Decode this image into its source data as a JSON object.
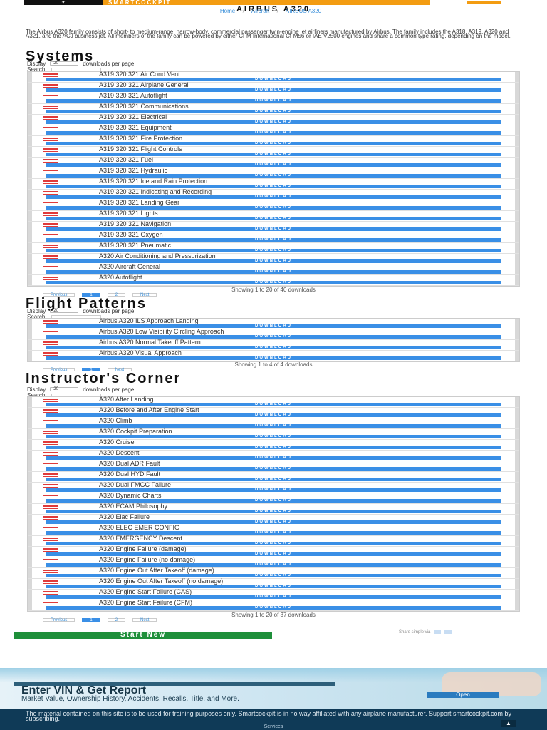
{
  "header": {
    "logo_text": "SMARTCOCKPIT",
    "plane_icon": "airplane-icon",
    "page_title": "AIRBUS A320",
    "breadcrumb": [
      "Home",
      "Aircraft",
      "AIRBUS A320"
    ]
  },
  "intro": "The Airbus A320 family consists of short- to medium-range, narrow-body, commercial passenger twin-engine jet airliners manufactured by Airbus. The family includes the A318, A319, A320 and A321, and the ACJ business jet. All members of the family can be powered by either CFM International CFM56 or IAE V2500 engines and share a common type rating, depending on the model.",
  "controls": {
    "display_label": "Display",
    "display_value": "20",
    "per_page_label": "downloads per page",
    "search_label": "Search:"
  },
  "download_label": "DOWNLOAD",
  "sections": {
    "systems": {
      "title": "Systems",
      "items": [
        "A319 320 321 Air Cond Vent",
        "A319 320 321 Airplane General",
        "A319 320 321 Autoflight",
        "A319 320 321 Communications",
        "A319 320 321 Electrical",
        "A319 320 321 Equipment",
        "A319 320 321 Fire Protection",
        "A319 320 321 Flight Controls",
        "A319 320 321 Fuel",
        "A319 320 321 Hydraulic",
        "A319 320 321 Ice and Rain Protection",
        "A319 320 321 Indicating and Recording",
        "A319 320 321 Landing Gear",
        "A319 320 321 Lights",
        "A319 320 321 Navigation",
        "A319 320 321 Oxygen",
        "A319 320 321 Pneumatic",
        "A320 Air Conditioning and Pressurization",
        "A320 Aircraft General",
        "A320 Autoflight"
      ],
      "showing": "Showing 1 to 20 of 40 downloads",
      "pager": [
        "Previous",
        "1",
        "2",
        "Next"
      ]
    },
    "patterns": {
      "title": "Flight Patterns",
      "items": [
        "Airbus A320 ILS Approach Landing",
        "Airbus A320 Low Visibility Circling Approach",
        "Airbus A320 Normal Takeoff Pattern",
        "Airbus A320 Visual Approach"
      ],
      "showing": "Showing 1 to 4 of 4 downloads",
      "pager": [
        "Previous",
        "1",
        "Next"
      ]
    },
    "instructor": {
      "title": "Instructor's Corner",
      "items": [
        "A320 After Landing",
        "A320 Before and After Engine Start",
        "A320 Climb",
        "A320 Cockpit Preparation",
        "A320 Cruise",
        "A320 Descent",
        "A320 Dual ADR Fault",
        "A320 Dual HYD Fault",
        "A320 Dual FMGC Failure",
        "A320 Dynamic Charts",
        "A320 ECAM Philosophy",
        "A320 Elac Failure",
        "A320 ELEC EMER CONFIG",
        "A320 EMERGENCY Descent",
        "A320 Engine Failure (damage)",
        "A320 Engine Failure (no damage)",
        "A320 Engine Out After Takeoff (damage)",
        "A320 Engine Out After Takeoff (no damage)",
        "A320 Engine Start Failure (CAS)",
        "A320 Engine Start Failure (CFM)"
      ],
      "showing": "Showing 1 to 20 of 37 downloads",
      "pager": [
        "Previous",
        "1",
        "2",
        "Next"
      ]
    }
  },
  "start_new": "Start New",
  "share_text": "Share simple via",
  "ad": {
    "headline": "Enter VIN & Get Report",
    "subtext": "Market Value, Ownership History, Accidents, Recalls, Title, and More.",
    "open_label": "Open"
  },
  "footer": {
    "text": "The material contained on this site is to be used for training purposes only. Smartcockpit is in no way affiliated with any airplane manufacturer. Support smartcockpit.com by subscribing.",
    "links": "Services"
  }
}
